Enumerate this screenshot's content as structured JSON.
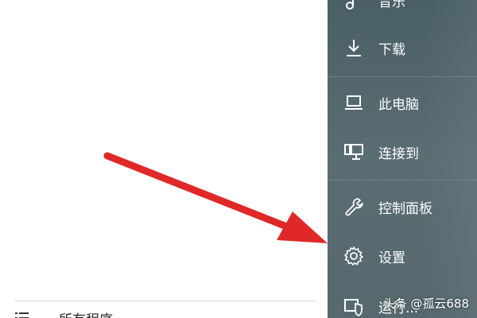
{
  "menu": {
    "items": [
      {
        "label": "音乐",
        "icon": "music-icon"
      },
      {
        "label": "下载",
        "icon": "download-icon"
      },
      {
        "label": "此电脑",
        "icon": "laptop-icon"
      },
      {
        "label": "连接到",
        "icon": "connect-icon"
      },
      {
        "label": "控制面板",
        "icon": "wrench-icon"
      },
      {
        "label": "设置",
        "icon": "gear-icon"
      },
      {
        "label": "运行...",
        "icon": "run-shield-icon"
      }
    ]
  },
  "start": {
    "all_programs_label": "所有程序",
    "all_programs_icon": "list-icon"
  },
  "annotation": {
    "arrow_color": "#e02828"
  },
  "watermark": "头条 @孤云688",
  "colors": {
    "menu_bg": "#4f6368",
    "menu_text": "#ffffff"
  }
}
